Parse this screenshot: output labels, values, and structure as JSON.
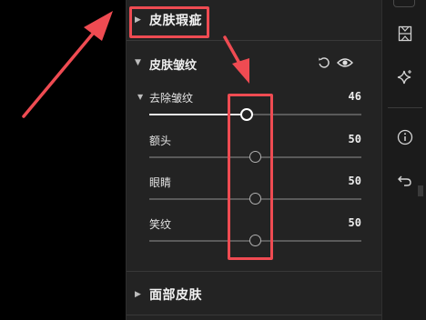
{
  "panel": {
    "sections": {
      "skin_blemish": {
        "label": "皮肤瑕疵"
      },
      "face_skin": {
        "label": "面部皮肤"
      }
    },
    "wrinkles": {
      "label": "皮肤皱纹",
      "icons": {
        "reset": "reset-icon",
        "visibility": "eye-icon"
      },
      "sliders": [
        {
          "label": "去除皱纹",
          "value": "46",
          "level": 46,
          "expandable": true,
          "active": true
        },
        {
          "label": "额头",
          "value": "50",
          "level": 50
        },
        {
          "label": "眼睛",
          "value": "50",
          "level": 50
        },
        {
          "label": "笑纹",
          "value": "50",
          "level": 50
        }
      ]
    }
  },
  "right_toolbar": {
    "icons": [
      "grid-icon",
      "sparkle-icon",
      "info-icon",
      "undo-icon"
    ]
  },
  "annotations": {
    "color": "#ef4b52"
  }
}
